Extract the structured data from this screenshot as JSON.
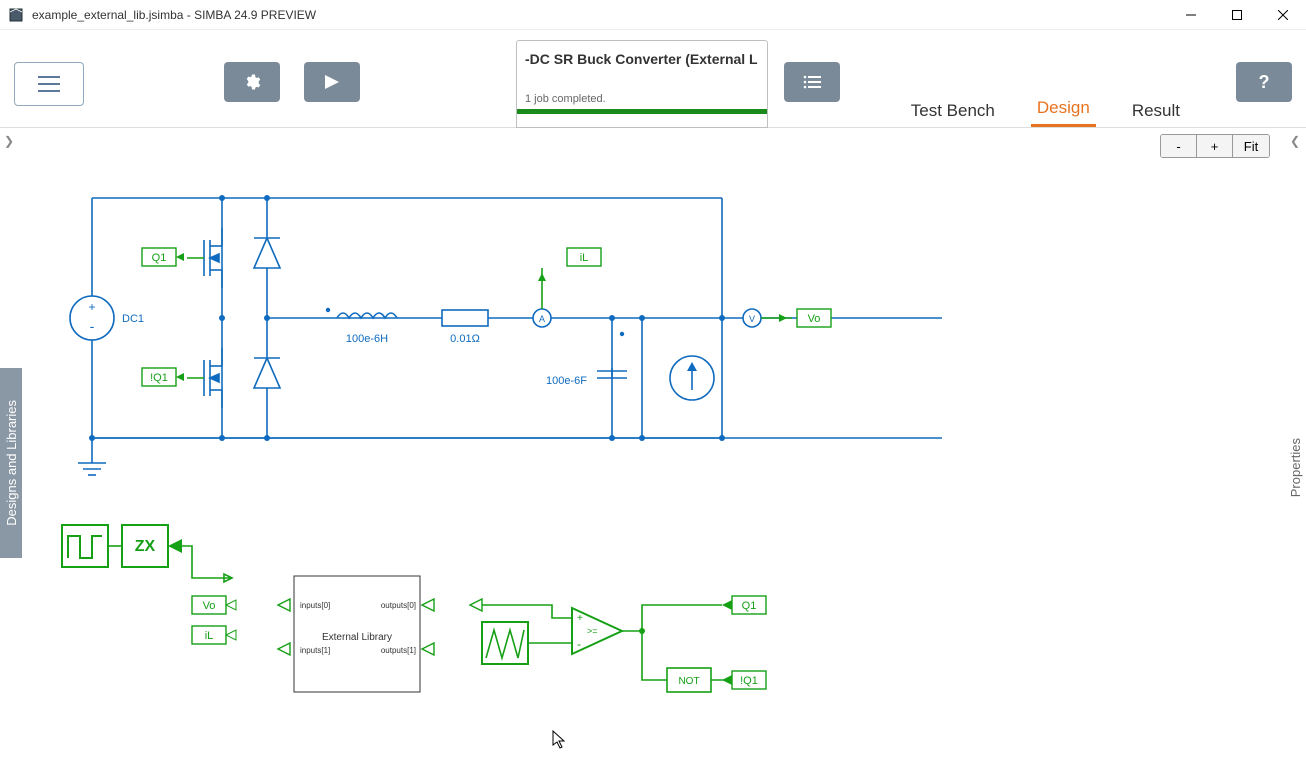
{
  "window": {
    "title": "example_external_lib.jsimba - SIMBA 24.9 PREVIEW"
  },
  "tab": {
    "title": "-DC SR Buck Converter (External L",
    "status": "1 job completed."
  },
  "nav": {
    "test_bench": "Test Bench",
    "design": "Design",
    "result": "Result"
  },
  "zoom": {
    "minus": "-",
    "plus": "+",
    "fit": "Fit"
  },
  "side_left": "Designs and Libraries",
  "side_right": "Properties",
  "help_label": "?",
  "schematic": {
    "dc1": "DC1",
    "q1": "Q1",
    "nq1": "!Q1",
    "il": "iL",
    "vo": "Vo",
    "inductor": "100e-6H",
    "resistor": "0.01Ω",
    "capacitor": "100e-6F",
    "ammeter": "A",
    "voltmeter": "V",
    "zx": "ZX",
    "extlib": "External Library",
    "in0": "inputs[0]",
    "in1": "inputs[1]",
    "out0": "outputs[0]",
    "out1": "outputs[1]",
    "not": "NOT",
    "cmp": ">="
  }
}
